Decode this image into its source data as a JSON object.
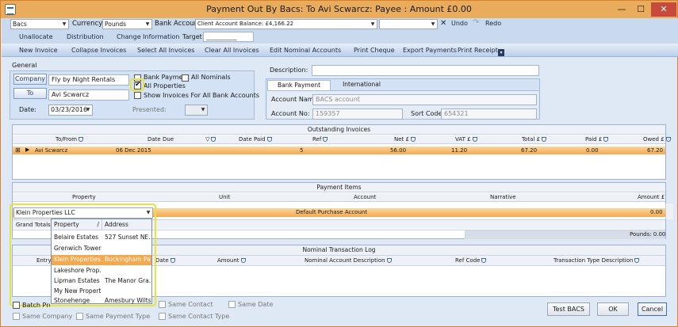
{
  "window": {
    "title": "Payment Out By Bacs: To Avi Scwarcz: Payee : Amount £0.00",
    "minimize": "—",
    "maximize": "☐",
    "close": "✕"
  },
  "toolbar": {
    "payment_method": "Bacs",
    "currency_label": "Currency",
    "currency_value": "Pounds",
    "bank_account_label": "Bank Account",
    "bank_account_value": "Client Account  Balance: £4,166.22",
    "undo": "Undo",
    "redo": "Redo",
    "unallocate": "Unallocate",
    "distribution": "Distribution",
    "change_information": "Change Information",
    "target_label": "Target",
    "target_value": "___________"
  },
  "ribbon": {
    "new_invoice": "New Invoice",
    "collapse_invoices": "Collapse Invoices",
    "select_all_invoices": "Select All Invoices",
    "clear_all_invoices": "Clear All Invoices",
    "edit_nominal_accounts": "Edit Nominal Accounts",
    "print_cheque": "Print Cheque",
    "export_payments": "Export Payments",
    "print_receipt": "Print Receipt"
  },
  "general": {
    "header": "General",
    "company_button": "Company",
    "company_value": "Fly by Night Rentals",
    "to_button": "To",
    "to_value": "Avi Scwarcz",
    "date_label": "Date:",
    "date_value": "03/23/2016",
    "presented_label": "Presented:",
    "bank_payment": "Bank Payment",
    "all_nominals": "All Nominals",
    "all_properties": "All Properties",
    "show_invoices_all_banks": "Show Invoices For All Bank Accounts"
  },
  "description": {
    "label": "Description:",
    "value": ""
  },
  "bank_details": {
    "tab_bank": "Bank Payment Details",
    "tab_international": "International Details",
    "account_name_label": "Account Name:",
    "account_name_value": "BACS account",
    "account_no_label": "Account No:",
    "account_no_value": "159357",
    "sort_code_label": "Sort Code:",
    "sort_code_value": "654321"
  },
  "outstanding": {
    "title": "Outstanding Invoices",
    "columns": [
      "To/From",
      "Date Due",
      "Date Paid",
      "Ref",
      "Net £",
      "VAT £",
      "Total £",
      "Paid £",
      "Owed £"
    ],
    "row": {
      "to_from": "Avi Scwarcz",
      "date_due": "06 Dec 2015",
      "date_paid": "",
      "ref": "5",
      "net": "56.00",
      "vat": "11.20",
      "total": "67.20",
      "paid": "0.00",
      "owed": "67.20"
    }
  },
  "payment_items": {
    "title": "Payment Items",
    "columns": [
      "Property",
      "Unit",
      "Account",
      "Narrative",
      "Amount £"
    ],
    "row": {
      "property": "Klein Properties LLC",
      "unit": "",
      "account": "Default Purchase Account",
      "narrative": "",
      "amount": "0.00"
    },
    "grand_totals": "Grand Totals",
    "pounds_total": "Pounds: 0.00"
  },
  "property_dropdown": {
    "col_property": "Property",
    "col_address": "Address",
    "rows": [
      {
        "property": "Belaire Estates",
        "address": "527 Sunset NE..."
      },
      {
        "property": "Grenwich Towers",
        "address": ""
      },
      {
        "property": "Klein Properties...",
        "address": "Buckingham Pal..."
      },
      {
        "property": "Lakeshore Prop...",
        "address": ""
      },
      {
        "property": "Lipman Estates",
        "address": "The Manor Gra..."
      },
      {
        "property": "My New Property",
        "address": ""
      },
      {
        "property": "Stonehenge",
        "address": "Amesbury Wilts..."
      }
    ]
  },
  "nominal_log": {
    "title": "Nominal Transaction Log",
    "columns": [
      "Entry",
      "Date",
      "Amount",
      "Nominal Account Description",
      "Ref Code",
      "Transaction Type Description"
    ]
  },
  "footer": {
    "batch_prompt": "Batch Prom",
    "same_contact": "Same Contact",
    "same_date": "Same Date",
    "same_company": "Same Company",
    "same_payment_type": "Same Payment Type",
    "same_contact_type": "Same Contact Type",
    "test_bacs": "Test BACS",
    "ok": "OK",
    "cancel": "Cancel"
  }
}
